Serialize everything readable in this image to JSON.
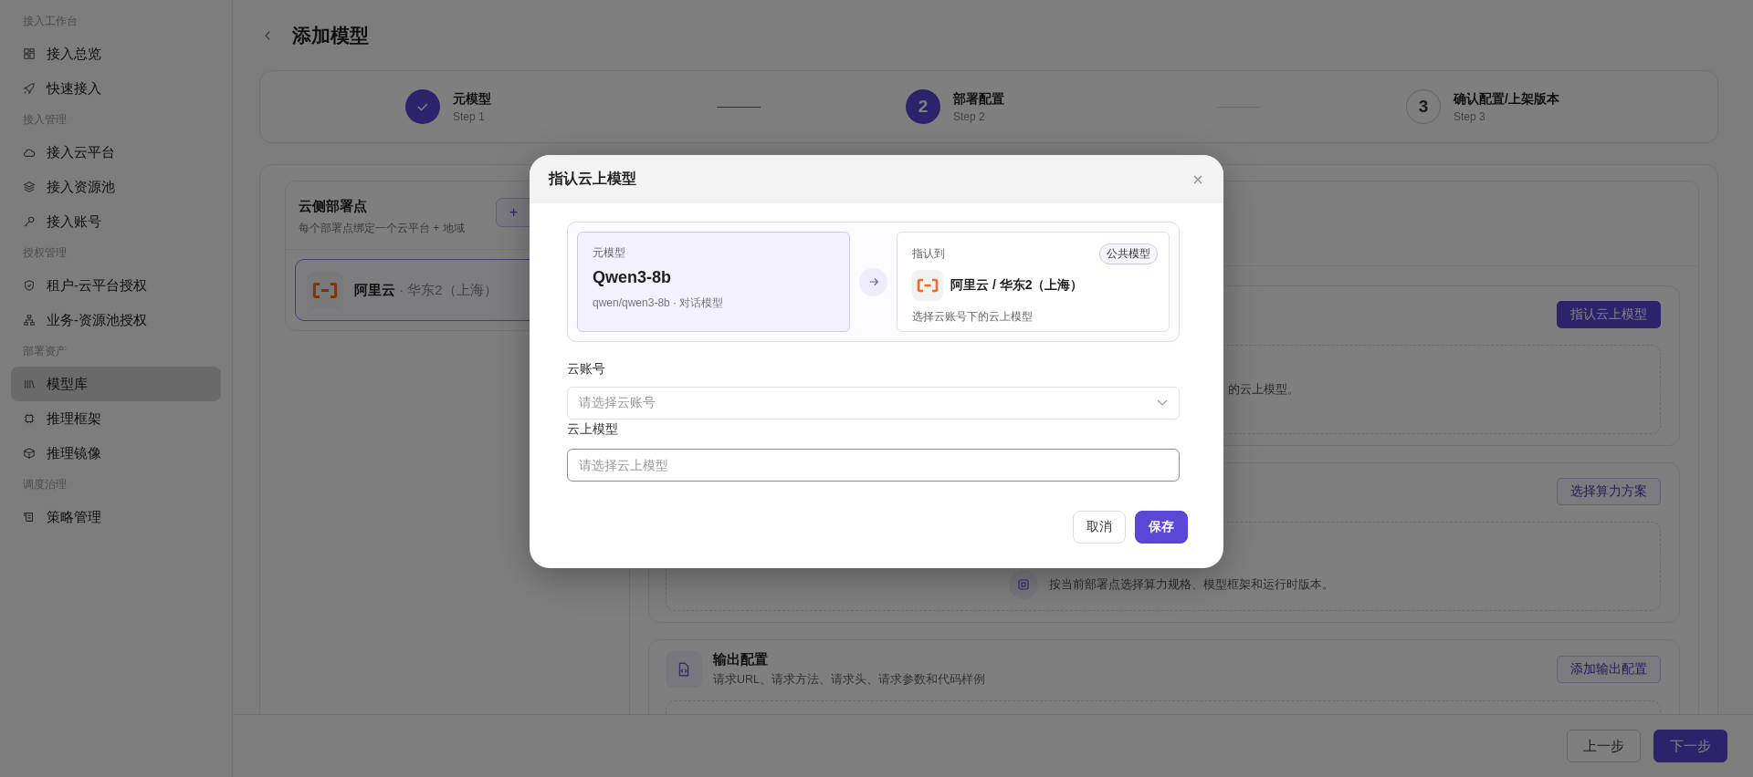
{
  "sidebar": {
    "groups": [
      {
        "label": "接入工作台",
        "items": [
          {
            "label": "接入总览",
            "selected": false
          },
          {
            "label": "快速接入",
            "selected": false
          }
        ]
      },
      {
        "label": "接入管理",
        "items": [
          {
            "label": "接入云平台",
            "selected": false
          },
          {
            "label": "接入资源池",
            "selected": false
          },
          {
            "label": "接入账号",
            "selected": false
          }
        ]
      },
      {
        "label": "授权管理",
        "items": [
          {
            "label": "租户-云平台授权",
            "selected": false
          },
          {
            "label": "业务-资源池授权",
            "selected": false
          }
        ]
      },
      {
        "label": "部署资产",
        "items": [
          {
            "label": "模型库",
            "selected": true
          },
          {
            "label": "推理框架",
            "selected": false
          },
          {
            "label": "推理镜像",
            "selected": false
          }
        ]
      },
      {
        "label": "调度治理",
        "items": [
          {
            "label": "策略管理",
            "selected": false
          }
        ]
      }
    ]
  },
  "page": {
    "title": "添加模型"
  },
  "steps": [
    {
      "title": "元模型",
      "subtitle": "Step 1",
      "completed": true,
      "active": false
    },
    {
      "number": "2",
      "title": "部署配置",
      "subtitle": "Step 2",
      "completed": false,
      "active": true
    },
    {
      "number": "3",
      "title": "确认配置/上架版本",
      "subtitle": "Step 3",
      "completed": false,
      "active": false
    }
  ],
  "deploy_points": {
    "title": "云侧部署点",
    "subtitle": "每个部署点绑定一个云平台 + 地域",
    "add_button": "+",
    "items": [
      {
        "provider": "阿里云",
        "region": "· 华东2（上海）",
        "selected": true
      }
    ]
  },
  "sections": [
    {
      "kind": "note",
      "button": "指认云上模型",
      "primary": true,
      "empty_text": "的云上模型。"
    },
    {
      "kind": "icon_note",
      "button": "选择算力方案",
      "primary": false,
      "empty_text": "按当前部署点选择算力规格、模型框架和运行时版本。"
    },
    {
      "kind": "titled",
      "title": "输出配置",
      "subtitle": "请求URL、请求方法、请求头、请求参数和代码样例",
      "button": "添加输出配置",
      "primary": false
    }
  ],
  "footer": {
    "prev": "上一步",
    "next": "下一步"
  },
  "modal": {
    "title": "指认云上模型",
    "source": {
      "label": "元模型",
      "name": "Qwen3-8b",
      "detail": "qwen/qwen3-8b · 对话模型"
    },
    "target": {
      "label": "指认到",
      "badge": "公共模型",
      "name": "阿里云 / 华东2（上海）",
      "hint": "选择云账号下的云上模型"
    },
    "fields": [
      {
        "kind": "select",
        "label": "云账号",
        "placeholder": "请选择云账号",
        "focused": false
      },
      {
        "kind": "input",
        "label": "云上模型",
        "placeholder": "请选择云上模型",
        "focused": true
      }
    ],
    "cancel": "取消",
    "save": "保存"
  }
}
